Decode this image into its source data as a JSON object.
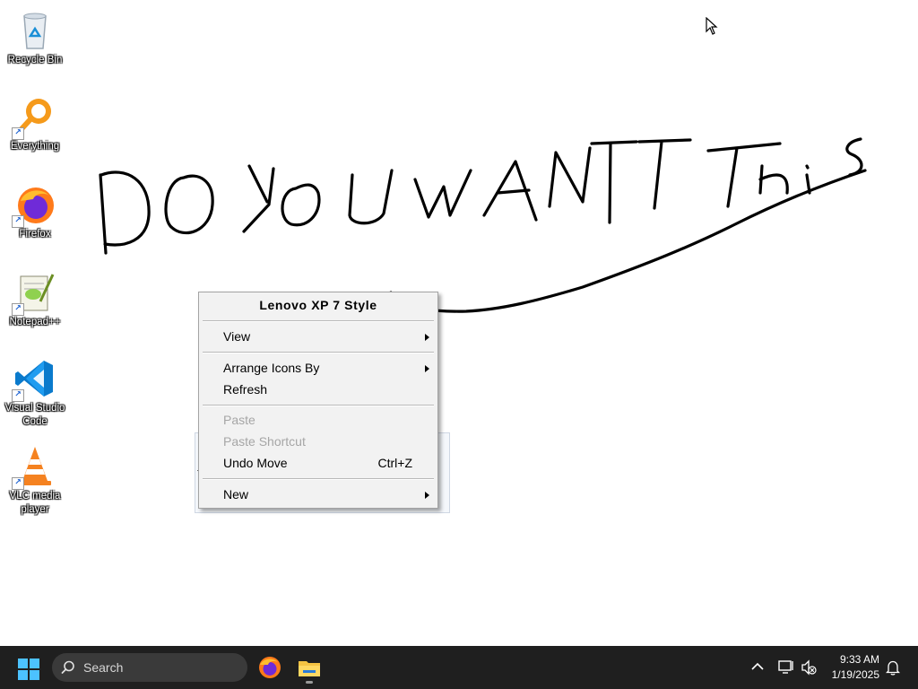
{
  "desktop": {
    "icons": [
      {
        "label": "Recycle Bin",
        "icon": "recycle-bin-icon"
      },
      {
        "label": "Everything",
        "icon": "everything-search-icon"
      },
      {
        "label": "Firefox",
        "icon": "firefox-icon"
      },
      {
        "label": "Notepad++",
        "icon": "notepad-plus-plus-icon"
      },
      {
        "label": "Visual Studio Code",
        "icon": "vscode-icon"
      },
      {
        "label": "VLC media player",
        "icon": "vlc-icon"
      }
    ],
    "handwriting": {
      "text": "DO YOU WANT THIS",
      "color": "#000000"
    }
  },
  "context_menu": {
    "header": "Lenovo XP 7 Style",
    "items": [
      {
        "label": "View",
        "submenu": true,
        "disabled": false
      },
      {
        "label": "Arrange Icons By",
        "submenu": true,
        "disabled": false
      },
      {
        "label": "Refresh",
        "submenu": false,
        "disabled": false
      },
      {
        "label": "Paste",
        "submenu": false,
        "disabled": true
      },
      {
        "label": "Paste Shortcut",
        "submenu": false,
        "disabled": true
      },
      {
        "label": "Undo Move",
        "shortcut": "Ctrl+Z",
        "submenu": false,
        "disabled": false
      },
      {
        "label": "New",
        "submenu": true,
        "disabled": false
      }
    ]
  },
  "background_window": {
    "visible_char": "f"
  },
  "taskbar": {
    "search_placeholder": "Search",
    "pinned": [
      "firefox-icon",
      "file-explorer-icon"
    ],
    "tray": {
      "time": "9:33 AM",
      "date": "1/19/2025"
    },
    "colors": {
      "bar": "#1f1f1f",
      "start_accent": "#4cc2ff"
    }
  }
}
